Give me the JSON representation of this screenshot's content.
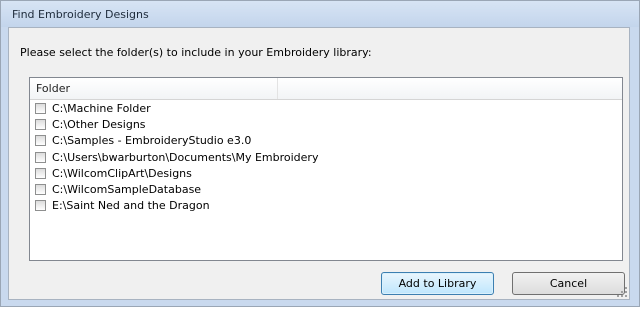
{
  "window": {
    "title": "Find Embroidery Designs"
  },
  "prompt": "Please select the folder(s) to include in your Embroidery library:",
  "list": {
    "column_header": "Folder",
    "items": [
      {
        "label": "C:\\Machine Folder",
        "checked": false
      },
      {
        "label": "C:\\Other Designs",
        "checked": false
      },
      {
        "label": "C:\\Samples - EmbroideryStudio e3.0",
        "checked": false
      },
      {
        "label": "C:\\Users\\bwarburton\\Documents\\My Embroidery",
        "checked": false
      },
      {
        "label": "C:\\WilcomClipArt\\Designs",
        "checked": false
      },
      {
        "label": "C:\\WilcomSampleDatabase",
        "checked": false
      },
      {
        "label": "E:\\Saint Ned and the Dragon",
        "checked": false
      }
    ]
  },
  "buttons": {
    "add_label": "Add to Library",
    "cancel_label": "Cancel"
  }
}
